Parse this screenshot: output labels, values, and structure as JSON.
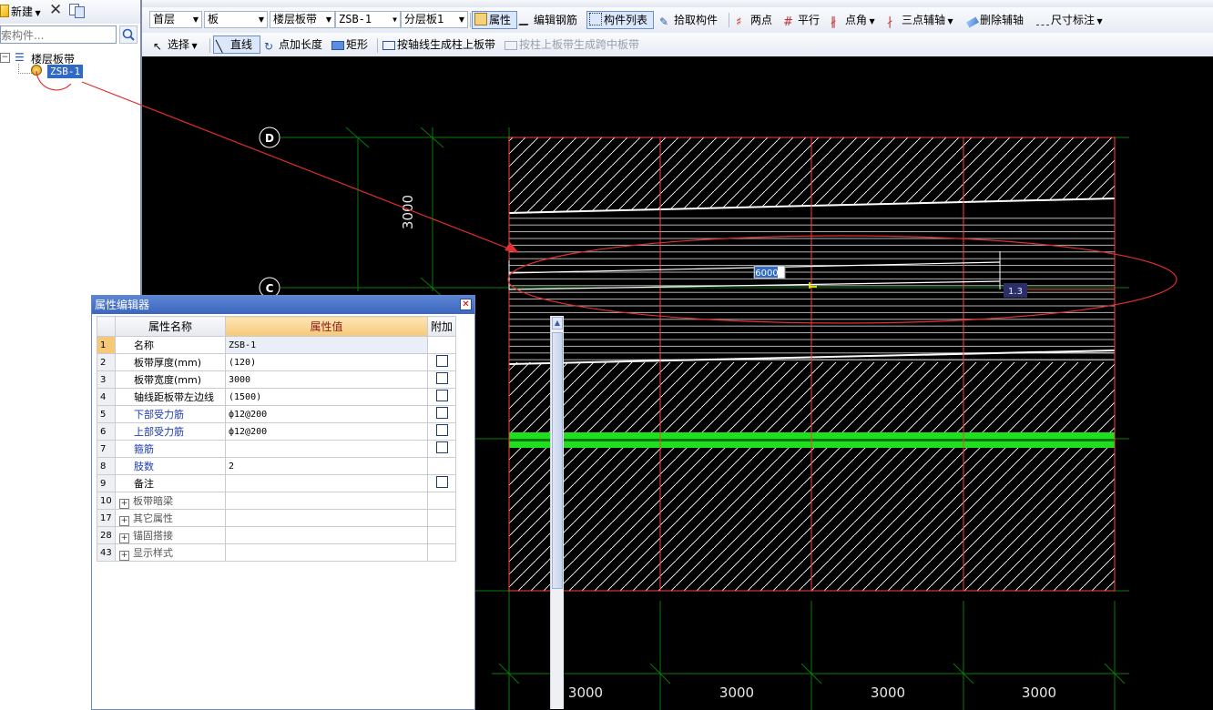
{
  "left_panel": {
    "new_label": "新建",
    "search_placeholder": "搜索构件...",
    "tree": {
      "root_label": "楼层板带",
      "child_label": "ZSB-1"
    }
  },
  "toolbar2": {
    "floor": "首层",
    "category": "板",
    "type": "楼层板带",
    "component": "ZSB-1",
    "layer": "分层板1",
    "properties": "属性",
    "edit_rebar": "编辑钢筋",
    "component_list": "构件列表",
    "pick_component": "拾取构件",
    "two_points": "两点",
    "parallel": "平行",
    "point_angle": "点角",
    "three_point_axis": "三点辅轴",
    "delete_axis": "删除辅轴",
    "dimension": "尺寸标注"
  },
  "toolbar3": {
    "select": "选择",
    "line": "直线",
    "point_length": "点加长度",
    "rect": "矩形",
    "by_axis": "按轴线生成柱上板带",
    "by_column": "按柱上板带生成跨中板带"
  },
  "property_editor": {
    "title": "属性编辑器",
    "headers": {
      "name": "属性名称",
      "value": "属性值",
      "extra": "附加"
    },
    "rows": [
      {
        "num": "1",
        "name": "名称",
        "value": "ZSB-1",
        "checkbox": false,
        "style": "normal",
        "selected": true
      },
      {
        "num": "2",
        "name": "板带厚度(mm)",
        "value": "(120)",
        "checkbox": true,
        "style": "normal"
      },
      {
        "num": "3",
        "name": "板带宽度(mm)",
        "value": "3000",
        "checkbox": true,
        "style": "normal"
      },
      {
        "num": "4",
        "name": "轴线距板带左边线",
        "value": "(1500)",
        "checkbox": true,
        "style": "normal"
      },
      {
        "num": "5",
        "name": "下部受力筋",
        "value": "ф12@200",
        "checkbox": true,
        "style": "blue"
      },
      {
        "num": "6",
        "name": "上部受力筋",
        "value": "ф12@200",
        "checkbox": true,
        "style": "blue"
      },
      {
        "num": "7",
        "name": "箍筋",
        "value": "",
        "checkbox": true,
        "style": "blue"
      },
      {
        "num": "8",
        "name": "肢数",
        "value": "2",
        "checkbox": false,
        "style": "blue"
      },
      {
        "num": "9",
        "name": "备注",
        "value": "",
        "checkbox": true,
        "style": "normal"
      },
      {
        "num": "10",
        "name": "板带暗梁",
        "value": "",
        "checkbox": false,
        "style": "group"
      },
      {
        "num": "17",
        "name": "其它属性",
        "value": "",
        "checkbox": false,
        "style": "group"
      },
      {
        "num": "28",
        "name": "锚固搭接",
        "value": "",
        "checkbox": false,
        "style": "group"
      },
      {
        "num": "43",
        "name": "显示样式",
        "value": "",
        "checkbox": false,
        "style": "group"
      }
    ]
  },
  "canvas": {
    "axis_labels": [
      "D",
      "C"
    ],
    "vertical_dim": "3000",
    "bottom_dims": [
      "3000",
      "3000",
      "3000",
      "3000"
    ],
    "input_length": "6000",
    "angle_readout": "1.3"
  },
  "colors": {
    "background": "#000000",
    "slab_border": "#ff4040",
    "grid_line": "#0a7a0a",
    "band": "#1ee01e",
    "annotation": "#e03030"
  }
}
